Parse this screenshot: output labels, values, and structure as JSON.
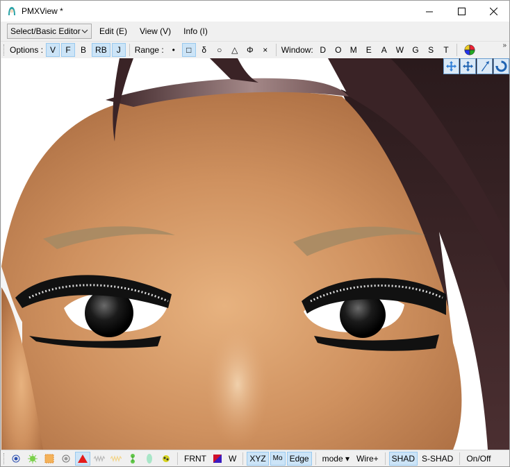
{
  "window": {
    "title": "PMXView *"
  },
  "menubar": {
    "mode_select": "Select/Basic Editor",
    "items": [
      "Edit (E)",
      "View (V)",
      "Info (I)"
    ]
  },
  "toolbar": {
    "options_label": "Options :",
    "options": [
      "V",
      "F",
      "B",
      "RB",
      "J"
    ],
    "range_label": "Range :",
    "range": [
      "•",
      "□",
      "δ",
      "○",
      "△",
      "Φ",
      "×"
    ],
    "window_label": "Window:",
    "windows": [
      "D",
      "O",
      "M",
      "E",
      "A",
      "W",
      "G",
      "S",
      "T"
    ],
    "overflow": "»"
  },
  "bottombar": {
    "frnt": "FRNT",
    "w": "W",
    "xyz": "XYZ",
    "mo": "Mo",
    "edge": "Edge",
    "mode": "mode ▾",
    "wire": "Wire+",
    "shad": "SHAD",
    "sshad": "S-SHAD",
    "onoff": "On/Off"
  },
  "colors": {
    "accent_on": "#cce4f7",
    "skin": "#c98b5e",
    "hair": "#3b2426"
  },
  "icons": [
    "app-icon",
    "minimize-icon",
    "maximize-icon",
    "close-icon",
    "color-wheel-icon",
    "move-xy-icon",
    "move-xz-icon",
    "move-icon",
    "rotate-icon"
  ]
}
